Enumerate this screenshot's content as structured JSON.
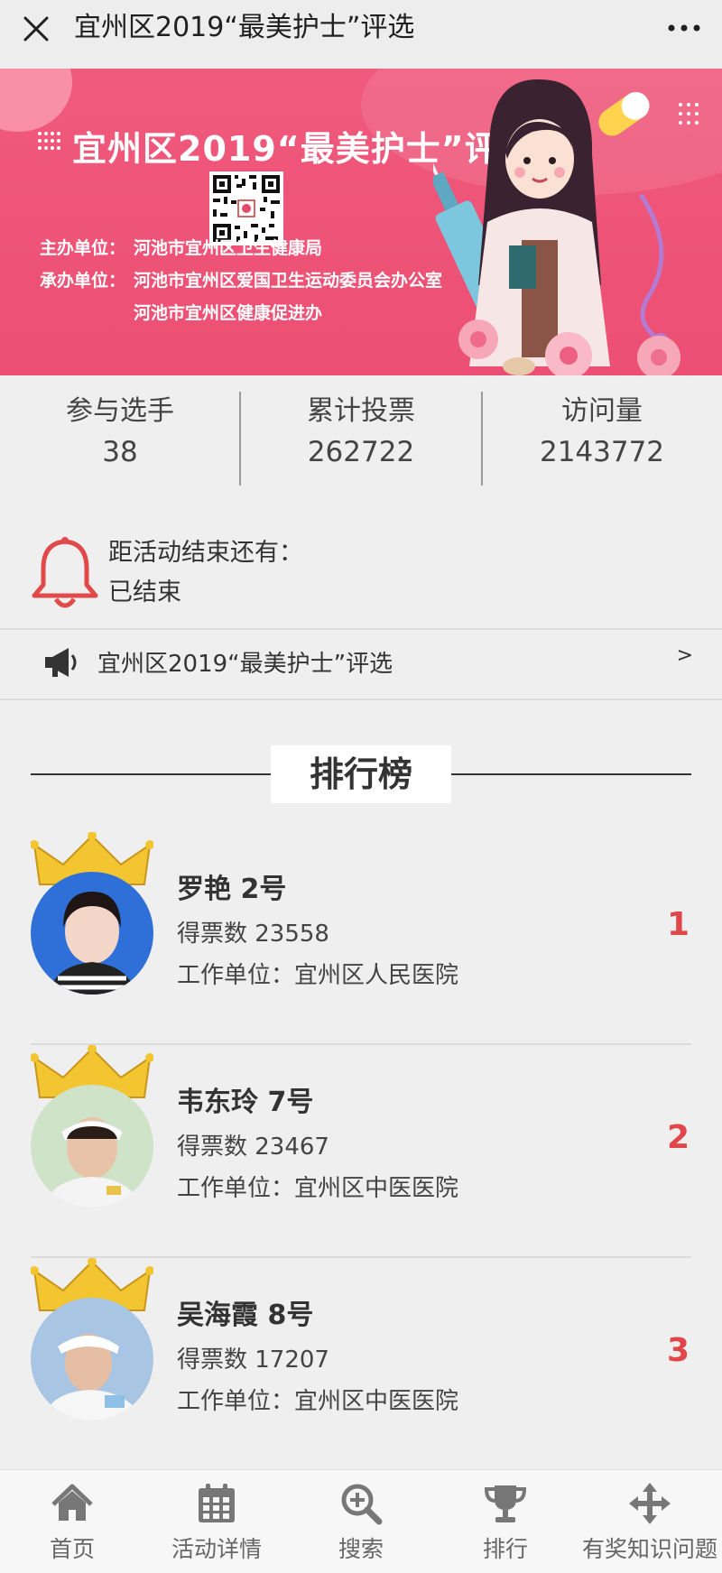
{
  "header": {
    "title": "宜州区2019“最美护士”评选"
  },
  "banner": {
    "title": "宜州区2019“最美护士”评选",
    "organizer_label": "主办单位：",
    "organizer": "河池市宜州区卫生健康局",
    "undertaker_label": "承办单位：",
    "undertaker_1": "河池市宜州区爱国卫生运动委员会办公室",
    "undertaker_2": "河池市宜州区健康促进办"
  },
  "stats": [
    {
      "label": "参与选手",
      "value": "38"
    },
    {
      "label": "累计投票",
      "value": "262722"
    },
    {
      "label": "访问量",
      "value": "2143772"
    }
  ],
  "countdown": {
    "label": "距活动结束还有：",
    "status": "已结束"
  },
  "notice": {
    "text": "宜州区2019“最美护士”评选",
    "arrow": ">"
  },
  "ranking": {
    "title": "排行榜",
    "items": [
      {
        "name": "罗艳  2号",
        "votes": "得票数 23558",
        "unit": "工作单位：宜州区人民医院",
        "rank": "1"
      },
      {
        "name": "韦东玲  7号",
        "votes": "得票数 23467",
        "unit": "工作单位：宜州区中医医院",
        "rank": "2"
      },
      {
        "name": "吴海霞  8号",
        "votes": "得票数 17207",
        "unit": "工作单位：宜州区中医医院",
        "rank": "3"
      }
    ]
  },
  "bottom_nav": [
    {
      "label": "首页",
      "icon": "home-icon"
    },
    {
      "label": "活动详情",
      "icon": "calendar-icon"
    },
    {
      "label": "搜索",
      "icon": "search-icon"
    },
    {
      "label": "排行",
      "icon": "trophy-icon"
    },
    {
      "label": "有奖知识问题",
      "icon": "move-icon"
    }
  ],
  "colors": {
    "banner": "#ec4f73",
    "rank_number": "#e0464a",
    "bell": "#e04a4a"
  }
}
